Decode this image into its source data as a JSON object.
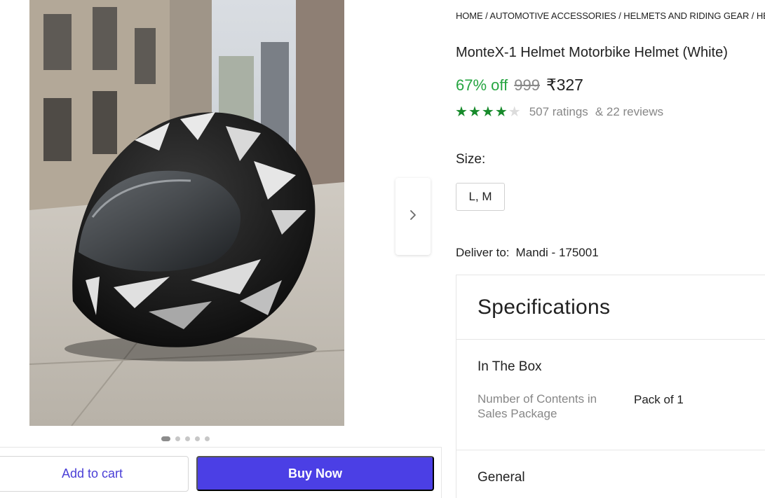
{
  "breadcrumb": "HOME / AUTOMOTIVE ACCESSORIES / HELMETS AND RIDING GEAR / HELMETS",
  "product": {
    "title": "MonteX-1 Helmet Motorbike Helmet (White)",
    "discount": "67% off",
    "mrp": "999",
    "price": "₹327",
    "rating_stars": 4,
    "ratings": "507 ratings",
    "reviews": "& 22 reviews"
  },
  "size": {
    "label": "Size:",
    "option": "L, M"
  },
  "delivery": {
    "label": "Deliver to:",
    "location": "Mandi - 175001"
  },
  "specifications": {
    "title": "Specifications",
    "groups": [
      {
        "name": "In The Box",
        "rows": [
          {
            "key": "Number of Contents in Sales Package",
            "value": "Pack of 1"
          }
        ]
      },
      {
        "name": "General"
      }
    ]
  },
  "gallery": {
    "image_count": 5,
    "active_index": 0
  },
  "actions": {
    "add_to_cart": "Add to cart",
    "buy_now": "Buy Now"
  },
  "colors": {
    "accent": "#4b3fe5",
    "discount": "#26a541",
    "star": "#178a2b"
  },
  "icons": {
    "next": "chevron-right-icon",
    "star": "star-icon"
  }
}
